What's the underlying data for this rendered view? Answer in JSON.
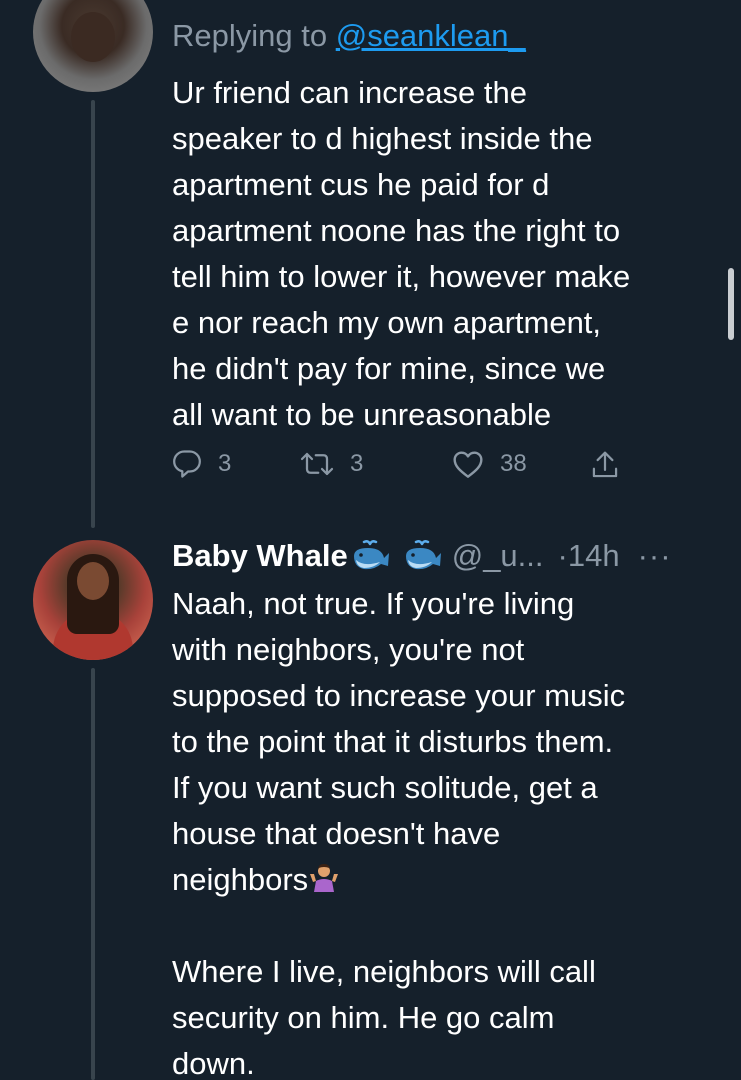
{
  "tweet1": {
    "reply_prefix": "Replying to ",
    "reply_mention": "@seanklean_",
    "text": "Ur friend can increase the\nspeaker to d highest inside the\napartment cus he paid for d\napartment noone has the right to\ntell him to lower it, however make\ne nor reach my own apartment,\nhe didn't pay for mine, since we\nall want to be unreasonable",
    "reply_count": "3",
    "retweet_count": "3",
    "like_count": "38"
  },
  "tweet2": {
    "display_name": "Baby Whale",
    "handle": "@_u...",
    "time": "·14h",
    "more": "···",
    "text_part1": "Naah, not true. If you're living\nwith neighbors, you're not\nsupposed to increase your music\nto the point that it disturbs them.\nIf you want such solitude, get a\nhouse that doesn't have\nneighbors",
    "text_part2": "\n\nWhere I live, neighbors will call\nsecurity on him. He go calm\ndown."
  },
  "colors": {
    "background": "#15202b",
    "secondary_text": "#8b98a5",
    "link": "#1d9bf0",
    "thread_line": "#38444d"
  },
  "icons": [
    "reply-icon",
    "retweet-icon",
    "like-icon",
    "share-icon",
    "whale-emoji-icon",
    "shrug-emoji-icon"
  ]
}
